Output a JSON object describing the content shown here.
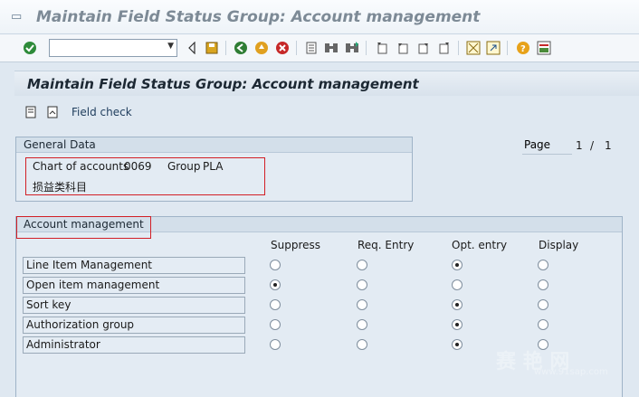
{
  "window": {
    "title": "Maintain Field Status Group: Account management"
  },
  "toolbar": {
    "command_value": ""
  },
  "screen": {
    "heading": "Maintain Field Status Group: Account management"
  },
  "app_toolbar": {
    "field_check_label": "Field check"
  },
  "general_data": {
    "title": "General Data",
    "chart_of_accounts_label": "Chart of accounts",
    "chart_of_accounts_value": "0069",
    "group_label": "Group",
    "group_value": "PLA",
    "group_description": "损益类科目"
  },
  "page": {
    "label": "Page",
    "current": "1",
    "separator": "/",
    "total": "1"
  },
  "account_management": {
    "title": "Account management",
    "columns": [
      "Suppress",
      "Req. Entry",
      "Opt. entry",
      "Display"
    ],
    "rows": [
      {
        "label": "Line Item Management",
        "selected": "Opt. entry"
      },
      {
        "label": "Open item management",
        "selected": "Suppress"
      },
      {
        "label": "Sort key",
        "selected": "Opt. entry"
      },
      {
        "label": "Authorization group",
        "selected": "Opt. entry"
      },
      {
        "label": "Administrator",
        "selected": "Opt. entry"
      }
    ]
  },
  "watermark": {
    "text": "赛 艳 网",
    "url": "www.91sap.com"
  },
  "icons": {
    "enter": "checkmark-icon",
    "back": "back-icon",
    "exit": "exit-icon",
    "cancel": "cancel-icon",
    "save": "save-icon",
    "print": "print-icon",
    "find": "find-icon",
    "find_next": "find-next-icon",
    "help": "help-icon"
  }
}
